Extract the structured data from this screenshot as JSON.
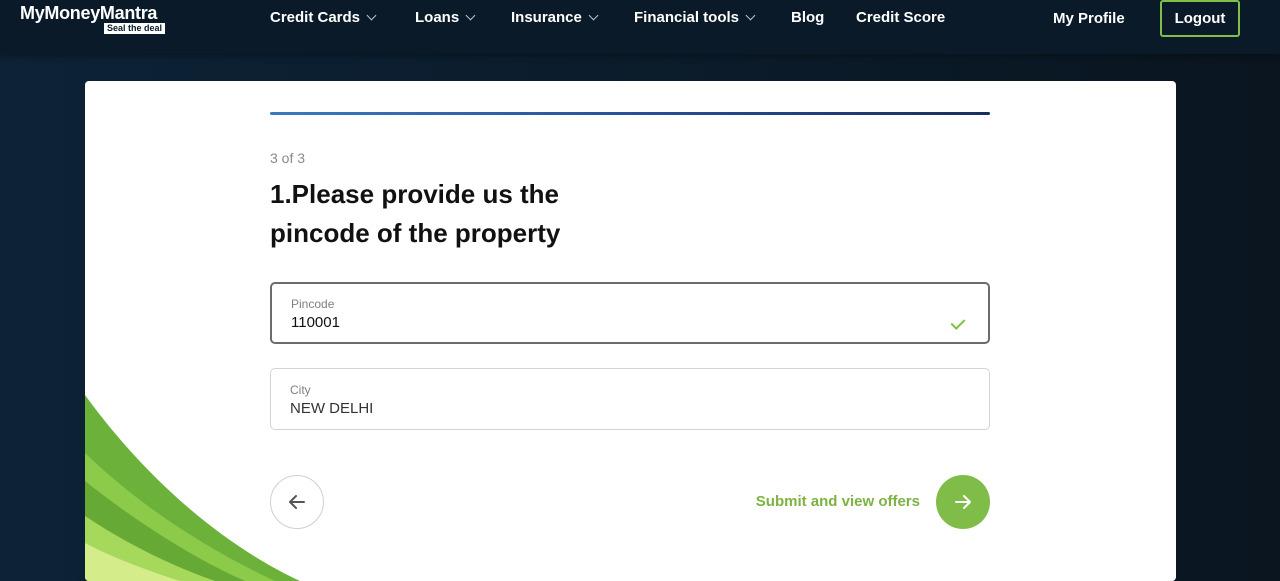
{
  "header": {
    "logo_text": "MyMoneyMantra",
    "logo_tagline": "Seal the deal",
    "nav": [
      {
        "label": "Credit Cards",
        "has_dropdown": true
      },
      {
        "label": "Loans",
        "has_dropdown": true
      },
      {
        "label": "Insurance",
        "has_dropdown": true
      },
      {
        "label": "Financial tools",
        "has_dropdown": true
      },
      {
        "label": "Blog",
        "has_dropdown": false
      },
      {
        "label": "Credit Score",
        "has_dropdown": false
      }
    ],
    "profile_label": "My Profile",
    "logout_label": "Logout"
  },
  "form": {
    "progress_fraction": 1.0,
    "step_text": "3 of 3",
    "question": "1.Please provide us the pincode of the property",
    "pincode": {
      "label": "Pincode",
      "value": "110001",
      "valid": true
    },
    "city": {
      "label": "City",
      "value": "NEW DELHI"
    },
    "back_icon": "arrow-left-icon",
    "submit_label": "Submit and view offers",
    "next_icon": "arrow-right-icon"
  },
  "colors": {
    "accent_green": "#80bd48",
    "progress_blue": "#3a79c2",
    "nav_bg": "#0a1a29"
  }
}
